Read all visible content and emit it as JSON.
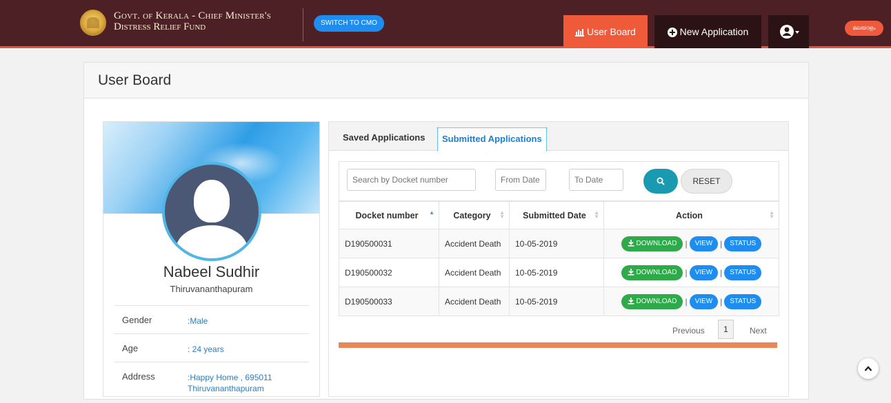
{
  "header": {
    "brand_line1": "Govt. of Kerala - Chief Minister's",
    "brand_line2": "Distress Relief Fund",
    "switch_label": "SWITCH TO CMO",
    "nav_userboard": "User Board",
    "nav_new_application": "New Application",
    "language_label": "മലയാളം",
    "colors": {
      "bar": "#4d2026",
      "accent": "#ef5b3a",
      "dark": "#2b1215"
    }
  },
  "page": {
    "title": "User Board"
  },
  "profile": {
    "name": "Nabeel Sudhir",
    "city": "Thiruvananthapuram",
    "fields": [
      {
        "label": "Gender",
        "value": ":Male"
      },
      {
        "label": "Age",
        "value": ": 24 years"
      },
      {
        "label": "Address",
        "value": ":Happy Home , 695011",
        "value2": "Thiruvananthapuram"
      }
    ]
  },
  "tabs": {
    "saved": "Saved Applications",
    "submitted": "Submitted Applications",
    "active": "submitted"
  },
  "filters": {
    "docket_placeholder": "Search by Docket number",
    "from_placeholder": "From Date",
    "to_placeholder": "To Date",
    "reset_label": "RESET"
  },
  "table": {
    "headers": [
      "Docket number",
      "Category",
      "Submitted Date",
      "Action"
    ],
    "rows": [
      {
        "docket": "D190500031",
        "category": "Accident Death",
        "date": "10-05-2019"
      },
      {
        "docket": "D190500032",
        "category": "Accident Death",
        "date": "10-05-2019"
      },
      {
        "docket": "D190500033",
        "category": "Accident Death",
        "date": "10-05-2019"
      }
    ],
    "actions": {
      "download": "DOWNLOAD",
      "view": "VIEW",
      "status": "STATUS",
      "separator": "|"
    }
  },
  "pagination": {
    "previous": "Previous",
    "current": "1",
    "next": "Next"
  }
}
